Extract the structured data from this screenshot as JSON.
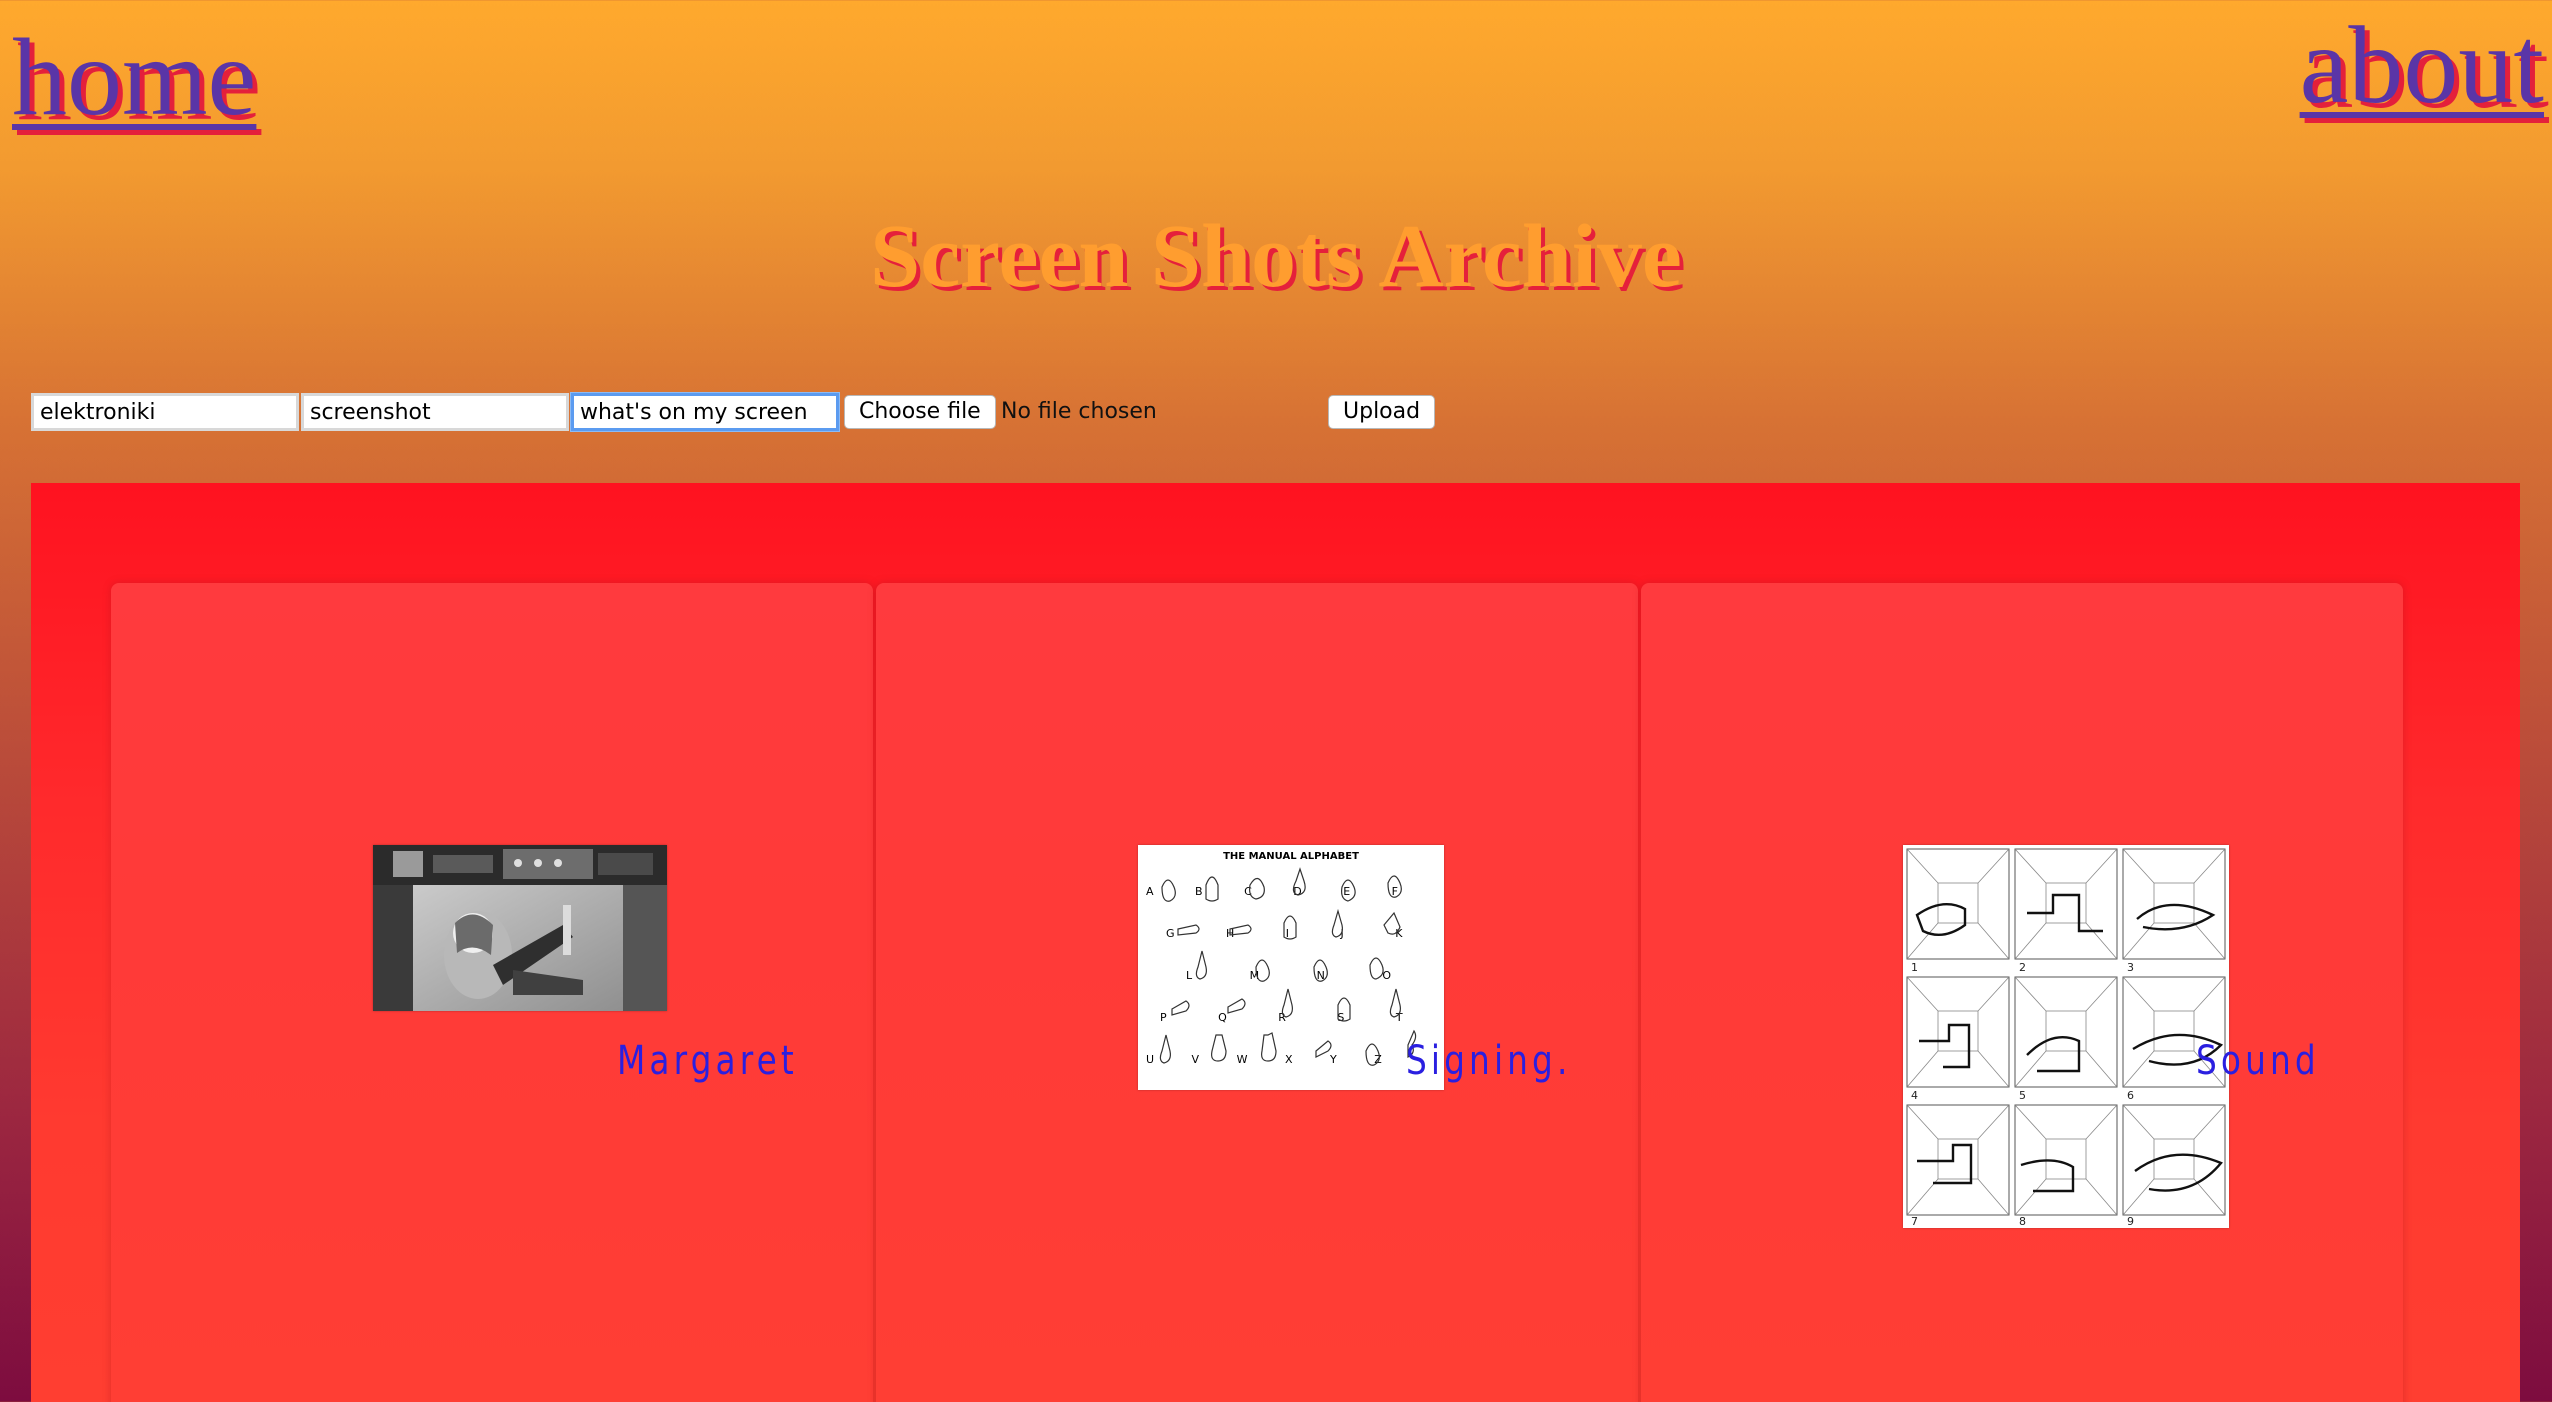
{
  "nav": {
    "home_label": "home",
    "about_label": "about"
  },
  "header": {
    "title": "Screen Shots Archive"
  },
  "upload_form": {
    "field_1_value": "elektroniki",
    "field_2_value": "screenshot",
    "field_3_value": "what's on my screen",
    "choose_file_label": "Choose file",
    "file_status": "No file chosen",
    "upload_label": "Upload"
  },
  "gallery": {
    "items": [
      {
        "caption": "Margaret",
        "image": "black-and-white photo of a woman at a computer console"
      },
      {
        "caption": "Signing.",
        "image": "THE MANUAL ALPHABET"
      },
      {
        "caption": "Sound",
        "image": "grid of nine perspective room diagrams"
      }
    ],
    "alphabet_rows": [
      "A B C D E F",
      "G H I J K",
      "L M N O",
      "P Q R S T",
      "U V W X Y Z"
    ],
    "sound_labels": [
      "1",
      "2",
      "3",
      "4",
      "5",
      "6",
      "7",
      "8",
      "9"
    ]
  },
  "colors": {
    "link": "#5a35a7",
    "link_shadow": "#e4203b",
    "title": "#ff9d2f",
    "caption": "#2a1fe0",
    "panel": "#ff2a2c"
  }
}
